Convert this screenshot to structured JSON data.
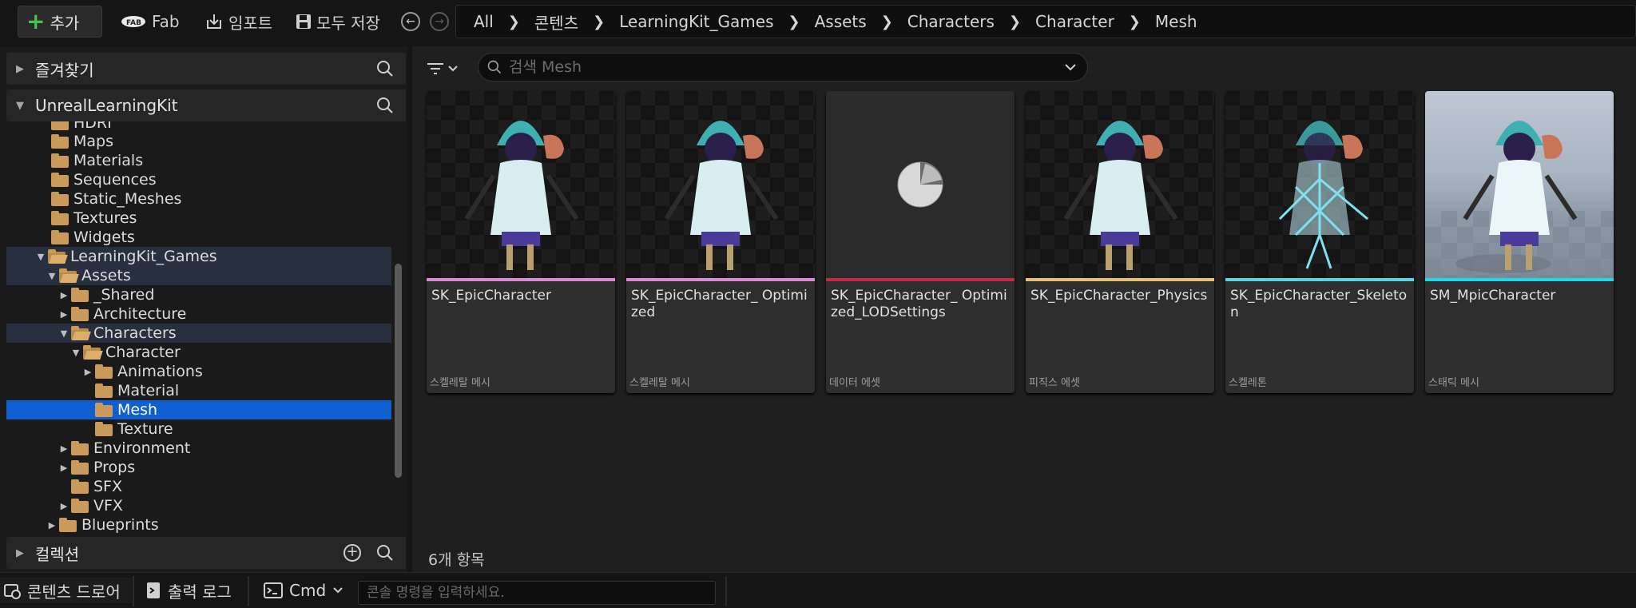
{
  "toolbar": {
    "add_label": "추가",
    "fab_label": "Fab",
    "import_label": "임포트",
    "save_all_label": "모두 저장"
  },
  "breadcrumb": [
    "All",
    "콘텐츠",
    "LearningKit_Games",
    "Assets",
    "Characters",
    "Character",
    "Mesh"
  ],
  "left_panel": {
    "favorites_label": "즐겨찾기",
    "root_label": "UnrealLearningKit",
    "collections_label": "컬렉션",
    "tree": [
      {
        "label": "HDRI"
      },
      {
        "label": "Maps"
      },
      {
        "label": "Materials"
      },
      {
        "label": "Sequences"
      },
      {
        "label": "Static_Meshes"
      },
      {
        "label": "Textures"
      },
      {
        "label": "Widgets"
      },
      {
        "label": "LearningKit_Games"
      },
      {
        "label": "Assets"
      },
      {
        "label": "_Shared"
      },
      {
        "label": "Architecture"
      },
      {
        "label": "Characters"
      },
      {
        "label": "Character"
      },
      {
        "label": "Animations"
      },
      {
        "label": "Material"
      },
      {
        "label": "Mesh"
      },
      {
        "label": "Texture"
      },
      {
        "label": "Environment"
      },
      {
        "label": "Props"
      },
      {
        "label": "SFX"
      },
      {
        "label": "VFX"
      },
      {
        "label": "Blueprints"
      }
    ]
  },
  "main": {
    "search_placeholder": "검색 Mesh",
    "item_count": "6개 항목",
    "assets": [
      {
        "name": "SK_EpicCharacter",
        "type": "스켈레탈 메시",
        "color": "#d98ad6"
      },
      {
        "name": "SK_EpicCharacter_ Optimized",
        "type": "스켈레탈 메시",
        "color": "#d98ad6"
      },
      {
        "name": "SK_EpicCharacter_ Optimized_LODSettings",
        "type": "데이터 에셋",
        "color": "#c8274a"
      },
      {
        "name": "SK_EpicCharacter_Physics",
        "type": "피직스 에셋",
        "color": "#e8c074"
      },
      {
        "name": "SK_EpicCharacter_Skeleton",
        "type": "스켈레톤",
        "color": "#5ed0e6"
      },
      {
        "name": "SM_MpicCharacter",
        "type": "스태틱 메시",
        "color": "#22d8e8"
      }
    ]
  },
  "statusbar": {
    "content_drawer_label": "콘텐츠 드로어",
    "output_log_label": "출력 로그",
    "cmd_label": "Cmd",
    "console_placeholder": "콘솔 명령을 입력하세요."
  }
}
